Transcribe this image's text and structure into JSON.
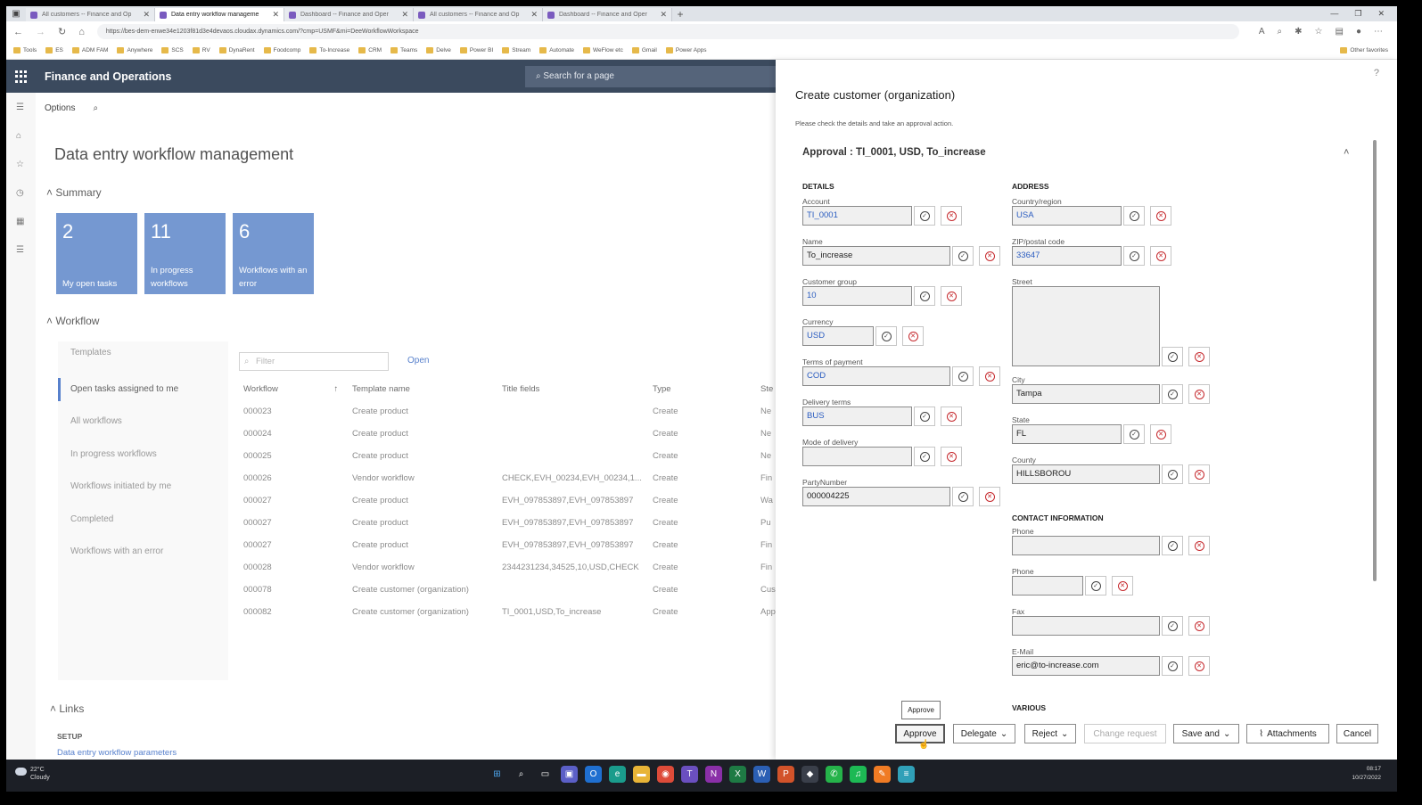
{
  "browser": {
    "tabs": [
      {
        "label": "All customers -- Finance and Op",
        "active": false
      },
      {
        "label": "Data entry workflow manageme",
        "active": true
      },
      {
        "label": "Dashboard -- Finance and Oper",
        "active": false
      },
      {
        "label": "All customers -- Finance and Op",
        "active": false
      },
      {
        "label": "Dashboard -- Finance and Oper",
        "active": false
      }
    ],
    "url": "https://bes-dem-enwe34e1203f81d3e4devaos.cloudax.dynamics.com/?cmp=USMF&mi=DeeWorkflowWorkspace",
    "favorites": [
      "Tools",
      "ES",
      "ADM FAM",
      "Anywhere",
      "SCS",
      "RV",
      "DynaRent",
      "Foodcomp",
      "To-Increase",
      "CRM",
      "Teams",
      "Delve",
      "Power BI",
      "Stream",
      "Automate",
      "WeFlow etc",
      "Gmail",
      "Power Apps"
    ],
    "other_favorites": "Other favorites"
  },
  "app": {
    "title": "Finance and Operations",
    "search_placeholder": "Search for a page",
    "options_label": "Options"
  },
  "main": {
    "page_title": "Data entry workflow management",
    "summary_label": "Summary",
    "tiles": [
      {
        "count": "2",
        "label": "My open tasks"
      },
      {
        "count": "11",
        "label": "In progress workflows"
      },
      {
        "count": "6",
        "label": "Workflows with an error"
      }
    ],
    "workflow_label": "Workflow",
    "templates_label": "Templates",
    "nav_items": [
      "Open tasks assigned to me",
      "All workflows",
      "In progress workflows",
      "Workflows initiated by me",
      "Completed",
      "Workflows with an error"
    ],
    "filter_placeholder": "Filter",
    "open_label": "Open",
    "columns": [
      "Workflow",
      "Template name",
      "Title fields",
      "Type",
      "Ste"
    ],
    "rows": [
      {
        "workflow": "000023",
        "template": "Create product",
        "title": "",
        "type": "Create",
        "step": "Ne"
      },
      {
        "workflow": "000024",
        "template": "Create product",
        "title": "",
        "type": "Create",
        "step": "Ne"
      },
      {
        "workflow": "000025",
        "template": "Create product",
        "title": "",
        "type": "Create",
        "step": "Ne"
      },
      {
        "workflow": "000026",
        "template": "Vendor workflow",
        "title": "CHECK,EVH_00234,EVH_00234,1...",
        "type": "Create",
        "step": "Fin"
      },
      {
        "workflow": "000027",
        "template": "Create product",
        "title": "EVH_097853897,EVH_097853897",
        "type": "Create",
        "step": "Wa"
      },
      {
        "workflow": "000027",
        "template": "Create product",
        "title": "EVH_097853897,EVH_097853897",
        "type": "Create",
        "step": "Pu"
      },
      {
        "workflow": "000027",
        "template": "Create product",
        "title": "EVH_097853897,EVH_097853897",
        "type": "Create",
        "step": "Fin"
      },
      {
        "workflow": "000028",
        "template": "Vendor workflow",
        "title": "2344231234,34525,10,USD,CHECK",
        "type": "Create",
        "step": "Fin"
      },
      {
        "workflow": "000078",
        "template": "Create customer (organization)",
        "title": "",
        "type": "Create",
        "step": "Cus"
      },
      {
        "workflow": "000082",
        "template": "Create customer (organization)",
        "title": "TI_0001,USD,To_increase",
        "type": "Create",
        "step": "App"
      }
    ],
    "links_label": "Links",
    "setup_label": "SETUP",
    "param_link": "Data entry workflow parameters"
  },
  "panel": {
    "title": "Create customer (organization)",
    "subtitle": "Please check the details and take an approval action.",
    "approval_header": "Approval : TI_0001, USD, To_increase",
    "details_label": "DETAILS",
    "address_label": "ADDRESS",
    "contact_label": "CONTACT INFORMATION",
    "various_label": "VARIOUS",
    "details": [
      {
        "label": "Account",
        "value": "TI_0001"
      },
      {
        "label": "Name",
        "value": "To_increase"
      },
      {
        "label": "Customer group",
        "value": "10"
      },
      {
        "label": "Currency",
        "value": "USD"
      },
      {
        "label": "Terms of payment",
        "value": "COD"
      },
      {
        "label": "Delivery terms",
        "value": "BUS"
      },
      {
        "label": "Mode of delivery",
        "value": ""
      },
      {
        "label": "PartyNumber",
        "value": "000004225"
      }
    ],
    "address": [
      {
        "label": "Country/region",
        "value": "USA"
      },
      {
        "label": "ZIP/postal code",
        "value": "33647"
      },
      {
        "label": "Street",
        "value": ""
      },
      {
        "label": "City",
        "value": "Tampa"
      },
      {
        "label": "State",
        "value": "FL"
      },
      {
        "label": "County",
        "value": "HILLSBOROU"
      }
    ],
    "contact": [
      {
        "label": "Phone",
        "value": ""
      },
      {
        "label": "Phone",
        "value": ""
      },
      {
        "label": "Fax",
        "value": ""
      },
      {
        "label": "E-Mail",
        "value": "eric@to-increase.com"
      }
    ],
    "actions": {
      "tooltip": "Approve",
      "approve": "Approve",
      "delegate": "Delegate",
      "reject": "Reject",
      "change_request": "Change request",
      "save_and": "Save and",
      "attachments": "Attachments",
      "cancel": "Cancel"
    }
  },
  "taskbar": {
    "temperature": "22°C",
    "weather": "Cloudy",
    "time": "08:17",
    "date": "10/27/2022"
  }
}
